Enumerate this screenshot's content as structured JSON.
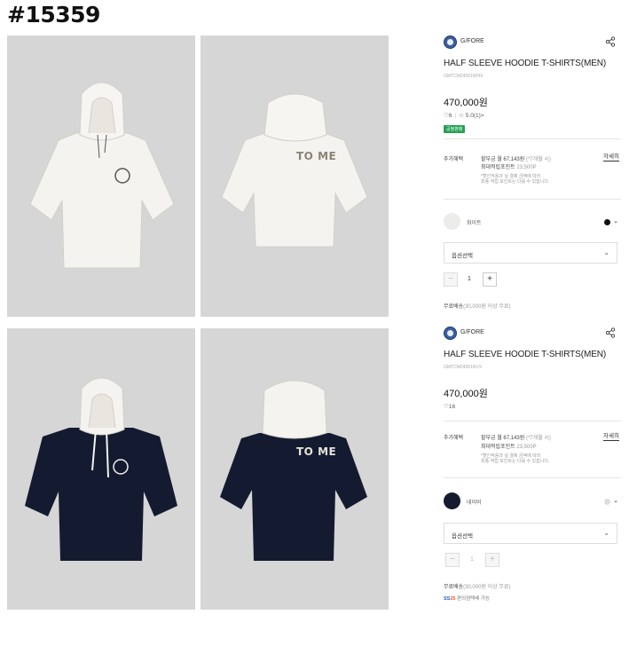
{
  "page_id": "#15359",
  "products": [
    {
      "brand": "G/FORE",
      "title": "HALF SLEEVE HOODIE T-SHIRTS(MEN)",
      "sku": "GMTCM24001WHX",
      "price": "470,000원",
      "likes": "6",
      "rating": "5.0(1)",
      "rating_suffix": ">",
      "badge": "공정판매",
      "benefit_label": "추가혜택",
      "installment": "할부금 월 67,143원",
      "installment_note": "(*7개월 시)",
      "points_label": "최대적립포인트",
      "points_value": "23,500P",
      "notes": [
        "*할인적용과 실 결제 금액에 따라",
        "최종 적립 포인트는 다를 수 있습니다."
      ],
      "detail_link": "자세히",
      "color_name": "화이트",
      "color_hex": "#ececea",
      "swatch_hex": "#111111",
      "option_label": "옵션선택",
      "qty": "1",
      "shipping_label": "무료배송",
      "shipping_note": "(30,000원 이상 무료)"
    },
    {
      "brand": "G/FORE",
      "title": "HALF SLEEVE HOODIE T-SHIRTS(MEN)",
      "sku": "GMTCM24001NVX",
      "price": "470,000원",
      "likes": "16",
      "benefit_label": "추가혜택",
      "installment": "할부금 월 67,143원",
      "installment_note": "(*7개월 시)",
      "points_label": "최대적립포인트",
      "points_value": "23,500P",
      "notes": [
        "*할인적용과 실 결제 금액에 따라",
        "최종 적립 포인트는 다를 수 있습니다."
      ],
      "detail_link": "자세히",
      "color_name": "네이비",
      "color_hex": "#151a2e",
      "swatch_hex": "#dddddd",
      "option_label": "옵션선택",
      "qty": "1",
      "shipping_label": "무료배송",
      "shipping_note": "(30,000원 이상 무료)",
      "pay_logo_a": "SS",
      "pay_logo_b": "25",
      "pay_note": "편의점택배 가능"
    }
  ],
  "back_print": "TO ME",
  "colors": {
    "bg_photo": "#d6d6d6",
    "white_shirt": "#f4f3ef",
    "navy_shirt": "#141a30",
    "badge_green": "#27a154"
  }
}
